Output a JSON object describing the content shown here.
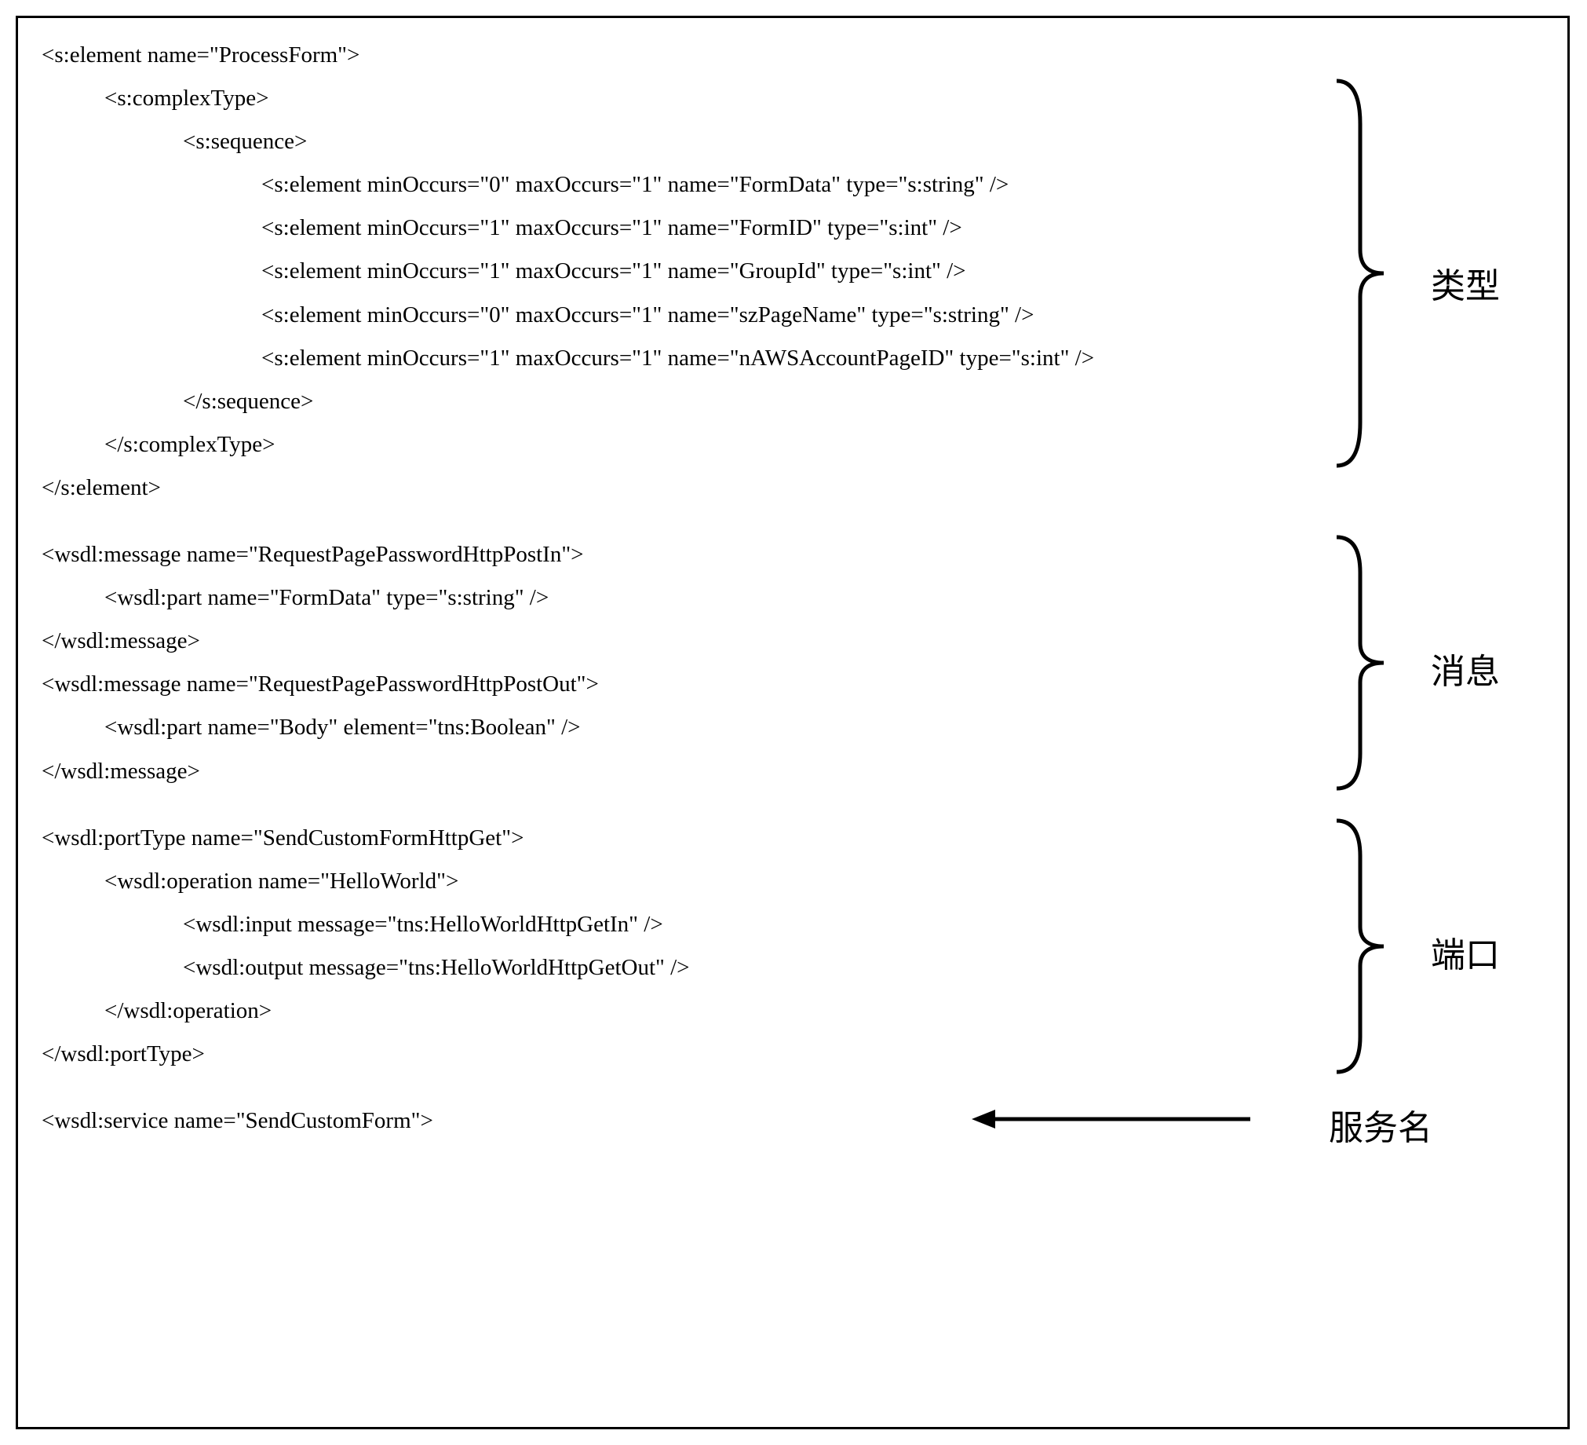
{
  "section1": {
    "label": "类型",
    "lines": [
      {
        "indent": 0,
        "text": "<s:element name=\"ProcessForm\">"
      },
      {
        "indent": 1,
        "text": "<s:complexType>"
      },
      {
        "indent": 2,
        "text": "<s:sequence>"
      },
      {
        "indent": 3,
        "text": "<s:element minOccurs=\"0\" maxOccurs=\"1\" name=\"FormData\" type=\"s:string\" />"
      },
      {
        "indent": 3,
        "text": "<s:element minOccurs=\"1\" maxOccurs=\"1\" name=\"FormID\" type=\"s:int\" />"
      },
      {
        "indent": 3,
        "text": "<s:element minOccurs=\"1\" maxOccurs=\"1\" name=\"GroupId\" type=\"s:int\" />"
      },
      {
        "indent": 3,
        "text": "<s:element minOccurs=\"0\" maxOccurs=\"1\" name=\"szPageName\" type=\"s:string\" />"
      },
      {
        "indent": 3,
        "text": "<s:element minOccurs=\"1\" maxOccurs=\"1\" name=\"nAWSAccountPageID\" type=\"s:int\" />"
      },
      {
        "indent": 2,
        "text": "</s:sequence>"
      },
      {
        "indent": 1,
        "text": "</s:complexType>"
      },
      {
        "indent": 0,
        "text": "</s:element>"
      }
    ]
  },
  "section2": {
    "label": "消息",
    "lines": [
      {
        "indent": 0,
        "text": "<wsdl:message name=\"RequestPagePasswordHttpPostIn\">"
      },
      {
        "indent": 1,
        "text": "<wsdl:part name=\"FormData\" type=\"s:string\" />"
      },
      {
        "indent": 0,
        "text": "</wsdl:message>"
      },
      {
        "indent": 0,
        "text": "<wsdl:message name=\"RequestPagePasswordHttpPostOut\">"
      },
      {
        "indent": 1,
        "text": "<wsdl:part name=\"Body\" element=\"tns:Boolean\" />"
      },
      {
        "indent": 0,
        "text": "</wsdl:message>"
      }
    ]
  },
  "section3": {
    "label": "端口",
    "lines": [
      {
        "indent": 0,
        "text": "<wsdl:portType name=\"SendCustomFormHttpGet\">"
      },
      {
        "indent": 1,
        "text": "<wsdl:operation name=\"HelloWorld\">"
      },
      {
        "indent": 2,
        "text": "<wsdl:input message=\"tns:HelloWorldHttpGetIn\" />"
      },
      {
        "indent": 2,
        "text": "<wsdl:output message=\"tns:HelloWorldHttpGetOut\" />"
      },
      {
        "indent": 1,
        "text": "</wsdl:operation>"
      },
      {
        "indent": 0,
        "text": "</wsdl:portType>"
      }
    ]
  },
  "section4": {
    "label": "服务名",
    "lines": [
      {
        "indent": 0,
        "text": "<wsdl:service name=\"SendCustomForm\">"
      }
    ]
  }
}
